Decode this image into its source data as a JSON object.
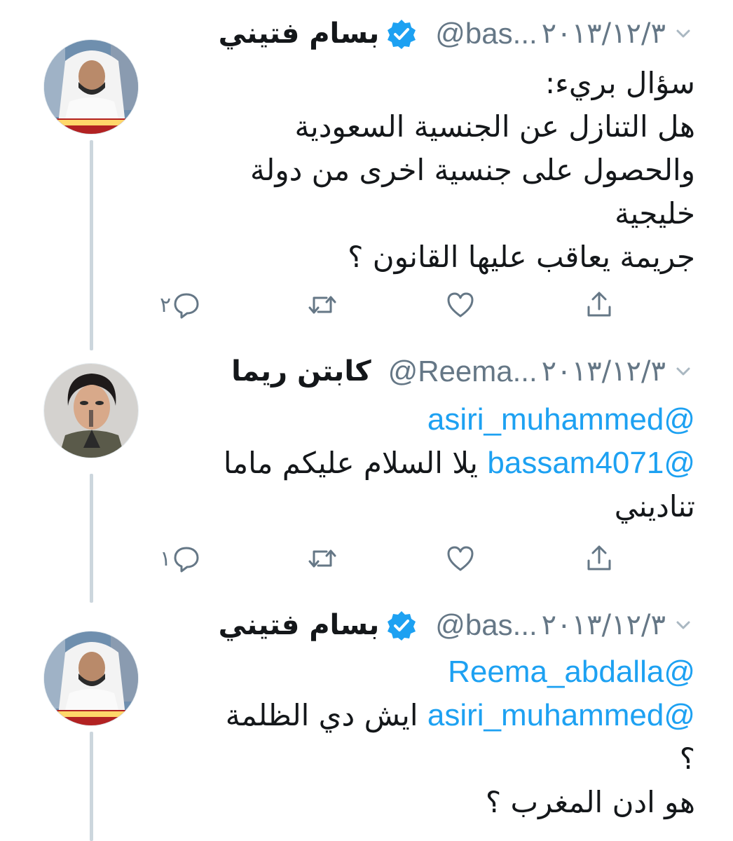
{
  "tweets": [
    {
      "display_name": "بسام فتيني",
      "handle": "@bas...",
      "date": "٢٠١٣/١٢/٣",
      "verified": true,
      "avatar": "news-anchor-avatar",
      "body_lines": [
        "سؤال بريء:",
        "هل التنازل عن الجنسية السعودية",
        "والحصول على جنسية اخرى من دولة",
        "خليجية",
        "جريمة يعاقب عليها القانون ؟"
      ],
      "reply_count": "٢"
    },
    {
      "display_name": "كابتن ريما",
      "handle": "@Reema...",
      "date": "٢٠١٣/١٢/٣",
      "verified": false,
      "avatar": "woman-avatar",
      "mention1": "@asiri_muhammed",
      "mention2": "@bassam4071",
      "line2_text": "يلا السلام عليكم ماما",
      "line3_text": "تناديني",
      "reply_count": "١"
    },
    {
      "display_name": "بسام فتيني",
      "handle": "@bas...",
      "date": "٢٠١٣/١٢/٣",
      "verified": true,
      "avatar": "news-anchor-avatar",
      "mention1": "@Reema_abdalla",
      "mention2": "@asiri_muhammed",
      "line2_text": "ايش دي الظلمة",
      "line3_text": "؟",
      "line4_text": "هو ادن المغرب ؟"
    }
  ],
  "colors": {
    "link": "#1da1f2",
    "secondary_text": "#657786",
    "thread_line": "#ccd6dd",
    "verified_badge": "#1da1f2"
  },
  "icons": [
    "chevron-down-icon",
    "verified-badge-icon",
    "reply-icon",
    "retweet-icon",
    "like-icon",
    "share-icon"
  ]
}
